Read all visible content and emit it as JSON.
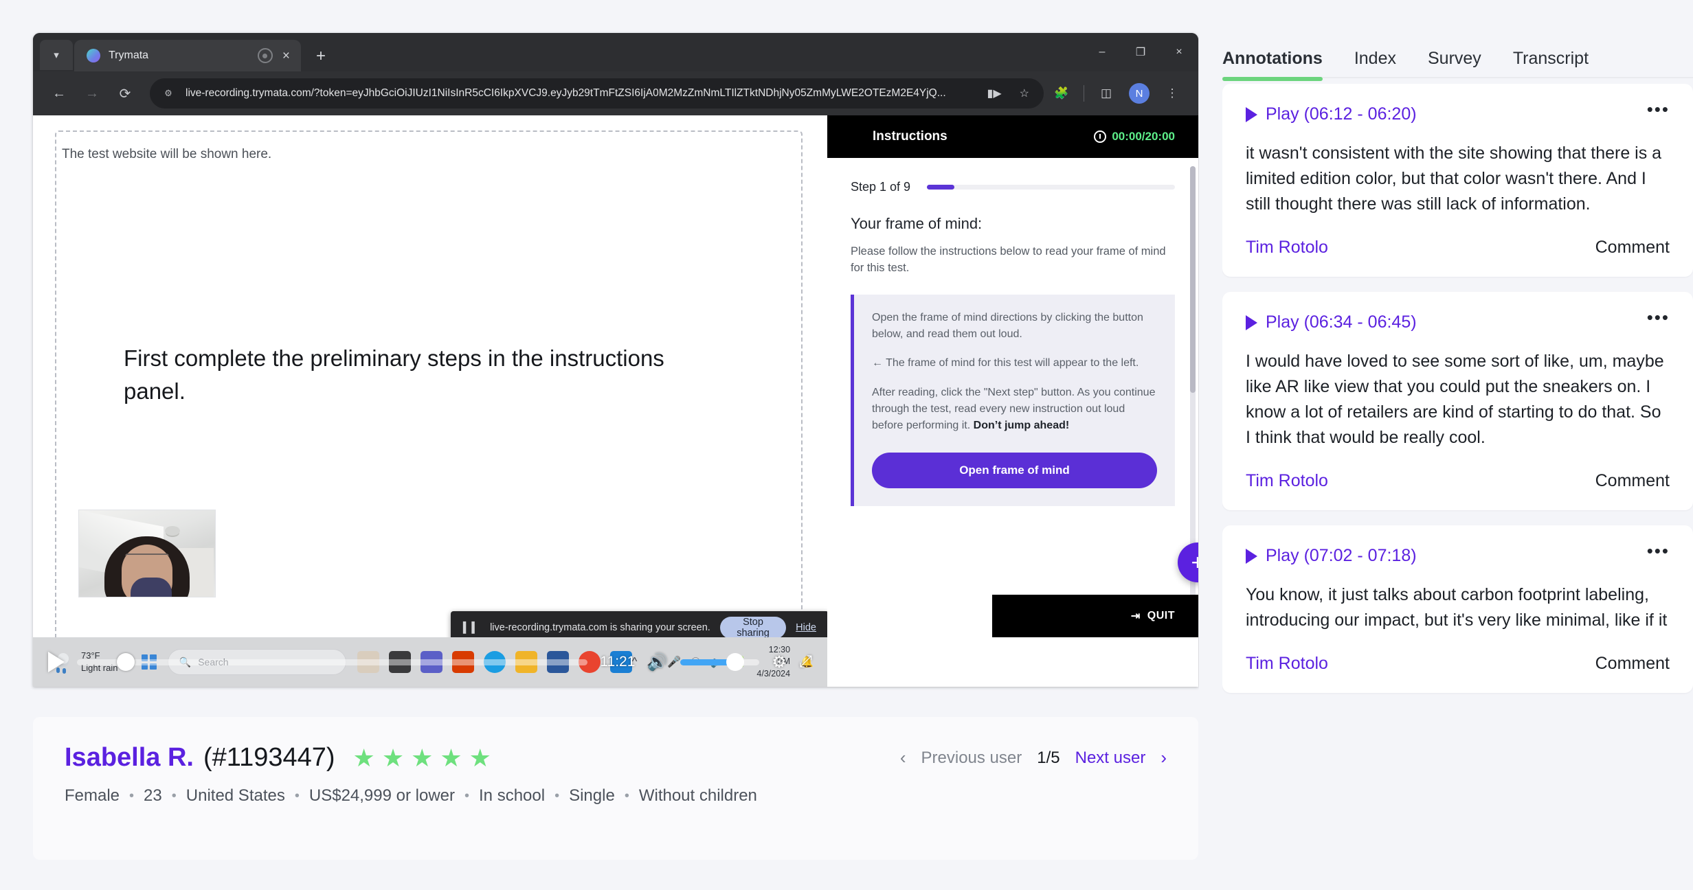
{
  "browser": {
    "tab_title": "Trymata",
    "url": "live-recording.trymata.com/?token=eyJhbGciOiJIUzI1NiIsInR5cCI6IkpXVCJ9.eyJyb29tTmFtZSI6IjA0M2MzZmNmLTIlZTktNDhjNy05ZmMyLWE2OTEzM2E4YjQ...",
    "profile_initial": "N",
    "new_tab_label": "+",
    "close_tab_label": "×",
    "minimize_label": "–",
    "maximize_label": "❐",
    "close_label": "×",
    "back_label": "←",
    "forward_label": "→",
    "reload_label": "⟳"
  },
  "recording": {
    "placeholder_note": "The test website will be shown here.",
    "center_message": "First complete the preliminary steps in the instructions panel.",
    "share_toast": {
      "text": "live-recording.trymata.com is sharing your screen.",
      "stop_label": "Stop sharing",
      "hide_label": "Hide"
    },
    "taskbar": {
      "weather_temp": "73°F",
      "weather_cond": "Light rain",
      "search_placeholder": "Search",
      "clock_time": "12:30 PM",
      "clock_date": "4/3/2024"
    },
    "player": {
      "duration": "11:21"
    },
    "quit_label": "QUIT",
    "add_label": "+"
  },
  "instructions": {
    "title": "Instructions",
    "timer": "00:00/20:00",
    "step_label": "Step 1 of 9",
    "heading": "Your frame of mind:",
    "subtext": "Please follow the instructions below to read your frame of mind for this test.",
    "quote_p1": "Open the frame of mind directions by clicking the button below, and read them out loud.",
    "quote_p2": "← The frame of mind for this test will appear to the left.",
    "quote_p3": "After reading, click the \"Next step\" button. As you continue through the test, read every new instruction out loud before performing it.",
    "quote_bold": "Don’t jump ahead!",
    "button_label": "Open frame of mind"
  },
  "user": {
    "name": "Isabella R.",
    "id": "(#1193447)",
    "stars": 5,
    "star_glyph": "★",
    "attributes": [
      "Female",
      "23",
      "United States",
      "US$24,999 or lower",
      "In school",
      "Single",
      "Without children"
    ],
    "separator": "•",
    "pager": {
      "prev_label": "Previous user",
      "page_label": "1/5",
      "next_label": "Next user",
      "prev_chevron": "‹",
      "next_chevron": "›"
    }
  },
  "panel": {
    "tabs": [
      {
        "label": "Annotations",
        "active": true
      },
      {
        "label": "Index",
        "active": false
      },
      {
        "label": "Survey",
        "active": false
      },
      {
        "label": "Transcript",
        "active": false
      }
    ],
    "annotations": [
      {
        "play_label": "Play (06:12 - 06:20)",
        "text": "it wasn't consistent with the site showing that there is a limited edition color, but that color wasn't there. And I still thought there was still lack of information.",
        "author": "Tim Rotolo",
        "comment_label": "Comment",
        "menu_label": "•••"
      },
      {
        "play_label": "Play (06:34 - 06:45)",
        "text": "I would have loved to see some sort of like, um, maybe like AR like view that you could put the sneakers on. I know a lot of retailers are kind of starting to do that. So I think that would be really cool.",
        "author": "Tim Rotolo",
        "comment_label": "Comment",
        "menu_label": "•••"
      },
      {
        "play_label": "Play (07:02 - 07:18)",
        "text": "You know, it just talks about carbon footprint labeling, introducing our impact, but it's very like minimal, like if it",
        "author": "Tim Rotolo",
        "comment_label": "Comment",
        "menu_label": "•••"
      }
    ]
  },
  "colors": {
    "accent_purple": "#5b21e0",
    "accent_green": "#6cd47e",
    "timer_green": "#5df08a"
  }
}
